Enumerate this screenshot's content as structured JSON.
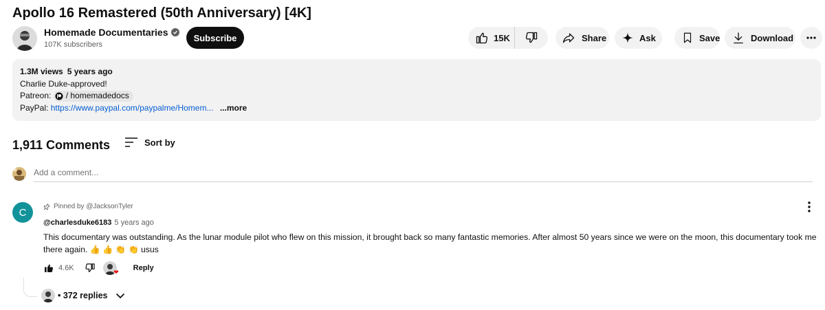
{
  "video": {
    "title": "Apollo 16 Remastered (50th Anniversary) [4K]"
  },
  "channel": {
    "name": "Homemade Documentaries",
    "subscribers": "107K subscribers",
    "subscribe_label": "Subscribe"
  },
  "actions": {
    "like_count": "15K",
    "share_label": "Share",
    "ask_label": "Ask",
    "save_label": "Save",
    "download_label": "Download"
  },
  "description": {
    "views": "1.3M views",
    "age": "5 years ago",
    "line1": "Charlie Duke-approved!",
    "patreon_label": "Patreon:",
    "patreon_handle": "/ homemadedocs",
    "paypal_label": "PayPal:",
    "paypal_link": "https://www.paypal.com/paypalme/Homem...",
    "more_label": "...more"
  },
  "comments": {
    "count_label": "1,911 Comments",
    "sort_label": "Sort by",
    "add_placeholder": "Add a comment...",
    "pinned": {
      "avatar_letter": "C",
      "pinned_by": "Pinned by @JacksonTyler",
      "author": "@charlesduke6183",
      "time": "5 years ago",
      "text": "This documentary was outstanding. As the lunar module pilot who flew on this mission, it brought back so many fantastic memories. After almost 50 years since we were on the moon, this documentary took me there again. 👍 👍 👏 👏 usus",
      "likes": "4.6K",
      "reply_label": "Reply",
      "replies_label": "• 372 replies"
    }
  },
  "colors": {
    "link": "#065fd4",
    "avatar_c": "#12939a",
    "pill_bg": "#f2f2f2",
    "heart": "#e01a1a"
  },
  "icons": [
    "verified-icon",
    "like-icon",
    "dislike-icon",
    "share-icon",
    "ask-sparkle-icon",
    "save-icon",
    "download-icon",
    "more-icon",
    "sort-icon",
    "pin-icon",
    "heart-icon",
    "chevron-down-icon",
    "patreon-icon"
  ]
}
